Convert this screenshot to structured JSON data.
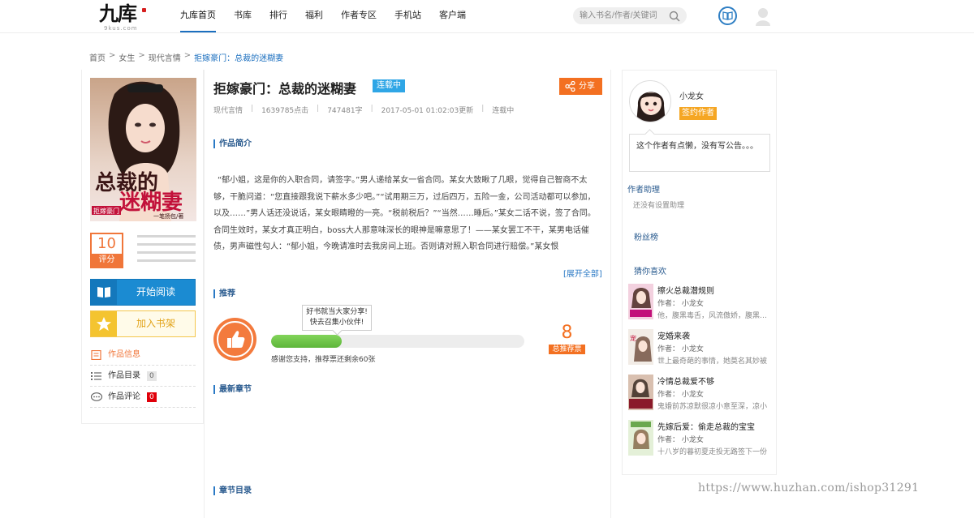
{
  "header": {
    "logo_text": "九库",
    "logo_sub": "9kus.com",
    "nav": [
      "九库首页",
      "书库",
      "排行",
      "福利",
      "作者专区",
      "手机站",
      "客户端"
    ],
    "search_placeholder": "输入书名/作者/关键词"
  },
  "breadcrumb": {
    "items": [
      "首页",
      "女生",
      "现代言情",
      "拒嫁豪门：总裁的迷糊妻"
    ]
  },
  "book": {
    "title": "拒嫁豪门：总裁的迷糊妻",
    "status_badge": "连载中",
    "share_label": "分享",
    "meta": {
      "category": "现代言情",
      "clicks": "1639785点击",
      "words": "747481字",
      "updated": "2017-05-01 01:02:03更新",
      "status": "连载中"
    },
    "score": "10",
    "score_label": "评分",
    "read_label": "开始阅读",
    "shelf_label": "加入书架",
    "menu": [
      {
        "label": "作品信息",
        "badge": ""
      },
      {
        "label": "作品目录",
        "badge": "0"
      },
      {
        "label": "作品评论",
        "badge": "0"
      }
    ],
    "cover_title": "总裁的迷糊妻",
    "cover_subtitle": "拒嫁豪门",
    "cover_author": "一笔扬包/著"
  },
  "sections": {
    "intro_title": "作品简介",
    "intro_text": "“郁小姐，这是你的入职合同，请签字。”男人递给某女一省合同。某女大致瞅了几眼，觉得自己智商不太够，干脆问道：“您直接跟我说下薪水多少吧。”“试用期三万，过后四万，五险一金，公司活动都可以参加，以及……”男人话还没说话，某女眼睛瞪的一亮。“税前税后？”“当然……睡后。”某女二话不说，签了合同。合同生效时，某女才真正明白，boss大人那意味深长的眼神是嘛意思了！——某女罢工不干，某男电话催债，男声磁性勾人：“郁小姐，今晚请准时去我房间上班。否则请对照入职合同进行赔偿。”某女恨",
    "more_label": "[展开全部]",
    "recommend_title": "推荐",
    "tooltip_line1": "好书就当大家分享!",
    "tooltip_line2": "快去召集小伙伴!",
    "progress_text": "感谢您支持，推荐票还剩余60张",
    "progress_percent": 28,
    "rec_count": "8",
    "rec_count_label": "总推荐票",
    "latest_title": "最新章节",
    "toc_title": "章节目录"
  },
  "author": {
    "name": "小龙女",
    "tag": "签约作者",
    "notice": "这个作者有点懒，没有写公告。。。",
    "assistant_title": "作者助理",
    "assistant_text": "还没有设置助理",
    "fans_title": "粉丝榜",
    "guess_title": "猜你喜欢"
  },
  "recommendations": [
    {
      "title": "擦火总裁潜规则",
      "author": "作者： 小龙女",
      "desc": "他，腹黑毒舌，风流傲娇，腹黑十足"
    },
    {
      "title": "宠婚来袭",
      "author": "作者： 小龙女",
      "desc": "世上最奇葩的事情，她莫名其妙被"
    },
    {
      "title": "冷情总裁爱不够",
      "author": "作者： 小龙女",
      "desc": "鬼婚前苏凉默很凉小意至深，凉小"
    },
    {
      "title": "先嫁后爱：偷走总裁的宝宝",
      "author": "作者： 小龙女",
      "desc": "十八岁的暮初夏走投无路签下一份"
    }
  ],
  "watermark": "https://www.huzhan.com/ishop31291",
  "colors": {
    "accent_blue": "#1b8bd2",
    "accent_orange": "#f37021",
    "accent_yellow": "#f4c430"
  }
}
